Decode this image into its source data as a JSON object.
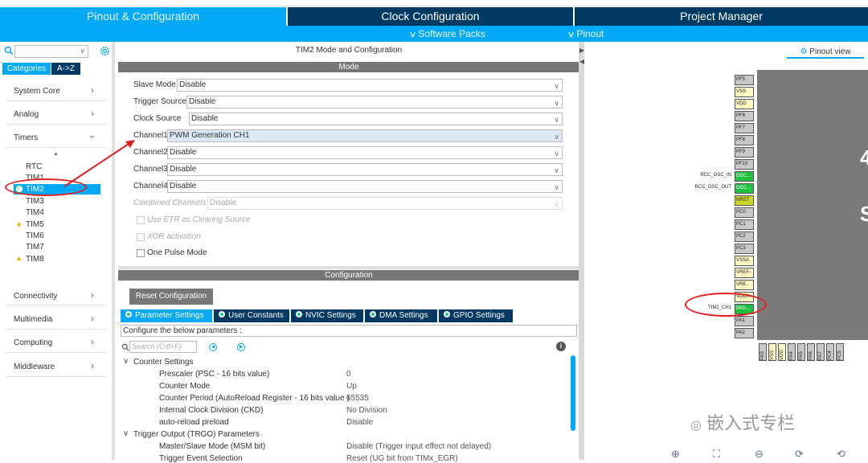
{
  "tabs": {
    "pinout": "Pinout & Configuration",
    "clock": "Clock Configuration",
    "project": "Project Manager"
  },
  "submenu": {
    "software_packs": "Software Packs",
    "pinout": "Pinout"
  },
  "left": {
    "categories_label": "Categories",
    "az_label": "A->Z",
    "groups": [
      "System Core",
      "Analog",
      "Timers",
      "Connectivity",
      "Multimedia",
      "Computing",
      "Middleware"
    ],
    "timers": [
      "RTC",
      "TIM1",
      "TIM2",
      "TIM3",
      "TIM4",
      "TIM5",
      "TIM6",
      "TIM7",
      "TIM8"
    ]
  },
  "mode": {
    "window_title": "TIM2 Mode and Configuration",
    "section_title": "Mode",
    "rows": [
      {
        "label": "Slave Mode",
        "value": "Disable"
      },
      {
        "label": "Trigger Source",
        "value": "Disable"
      },
      {
        "label": "Clock Source",
        "value": "Disable"
      },
      {
        "label": "Channel1",
        "value": "PWM Generation CH1"
      },
      {
        "label": "Channel2",
        "value": "Disable"
      },
      {
        "label": "Channel3",
        "value": "Disable"
      },
      {
        "label": "Channel4",
        "value": "Disable"
      },
      {
        "label": "Combined Channels",
        "value": "Disable"
      }
    ],
    "use_etr": "Use ETR as Clearing Source",
    "xor": "XOR activation",
    "one_pulse": "One Pulse Mode"
  },
  "config": {
    "section_title": "Configuration",
    "reset_label": "Reset Configuration",
    "tabs": [
      "Parameter Settings",
      "User Constants",
      "NVIC Settings",
      "DMA Settings",
      "GPIO Settings"
    ],
    "description": "Configure the below parameters :",
    "search_placeholder": "Search (Crtl+F)",
    "counter_settings": "Counter Settings",
    "params": [
      {
        "name": "Prescaler (PSC - 16 bits value)",
        "value": "0"
      },
      {
        "name": "Counter Mode",
        "value": "Up"
      },
      {
        "name": "Counter Period (AutoReload Register - 16 bits value )",
        "value": "65535"
      },
      {
        "name": "Internal Clock Division (CKD)",
        "value": "No Division"
      },
      {
        "name": "auto-reload preload",
        "value": "Disable"
      }
    ],
    "trgo_title": "Trigger Output (TRGO) Parameters",
    "trgo_params": [
      {
        "name": "Master/Slave Mode (MSM bit)",
        "value": "Disable (Trigger input effect not delayed)"
      },
      {
        "name": "Trigger Event Selection",
        "value": "Reset (UG bit from TIMx_EGR)"
      }
    ]
  },
  "pinout": {
    "view_label": "Pinout view",
    "pins": [
      {
        "label": "PF5",
        "color": "gray"
      },
      {
        "label": "VSS",
        "color": "yellow"
      },
      {
        "label": "VDD",
        "color": "yellow"
      },
      {
        "label": "PF6",
        "color": "gray"
      },
      {
        "label": "PF7",
        "color": "gray"
      },
      {
        "label": "PF8",
        "color": "gray"
      },
      {
        "label": "PF9",
        "color": "gray"
      },
      {
        "label": "PF10",
        "color": "gray"
      },
      {
        "label": "OSC...",
        "color": "green"
      },
      {
        "label": "OSC...",
        "color": "green"
      },
      {
        "label": "NRST",
        "color": "olive"
      },
      {
        "label": "PC0",
        "color": "gray"
      },
      {
        "label": "PC1",
        "color": "gray"
      },
      {
        "label": "PC2",
        "color": "gray"
      },
      {
        "label": "PC3",
        "color": "gray"
      },
      {
        "label": "VSSA",
        "color": "yellow"
      },
      {
        "label": "VREF-",
        "color": "yellow"
      },
      {
        "label": "VRE..",
        "color": "yellow"
      },
      {
        "label": "VDDA",
        "color": "yellow"
      },
      {
        "label": "PA0-..",
        "color": "green"
      },
      {
        "label": "PA1",
        "color": "gray"
      },
      {
        "label": "PA2",
        "color": "gray"
      }
    ],
    "bottom_pins": [
      "PA3",
      "VSS",
      "VDD",
      "PA4",
      "PA5",
      "PA6",
      "PA7",
      "PC4",
      "PC5"
    ],
    "signals": {
      "osc_in": "RCC_OSC_IN",
      "osc_out": "RCC_OSC_OUT",
      "tim2_ch1": "TIM2_CH1"
    },
    "chip_letters": [
      "4",
      "S"
    ],
    "watermark": "嵌入式专栏"
  }
}
